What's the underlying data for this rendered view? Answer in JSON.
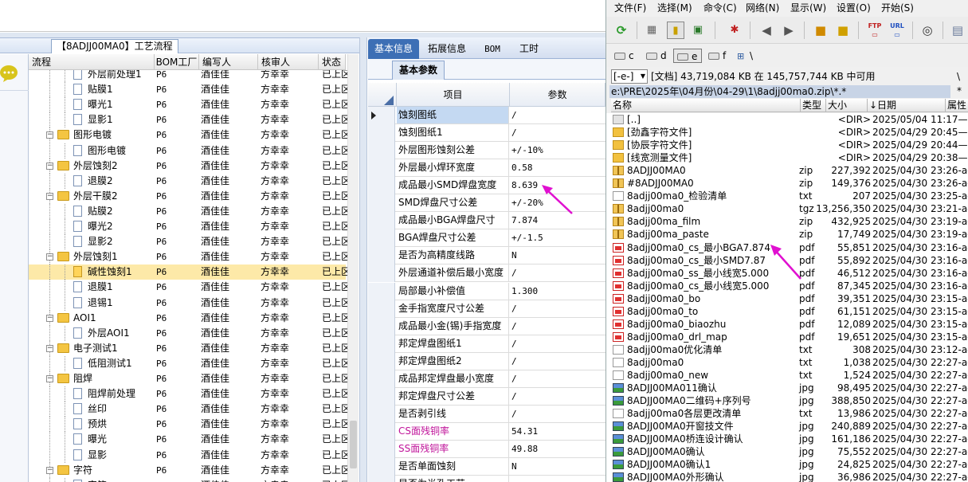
{
  "workflow_panel": {
    "title": "【8ADJJ00MA0】工艺流程",
    "columns": [
      "流程",
      "BOM工厂",
      "编写人",
      "核审人",
      "状态"
    ],
    "rows": [
      {
        "level": 2,
        "kind": "doc",
        "name": "外层前处理1",
        "bom": "P6",
        "author": "酒佳佳",
        "reviewer": "方幸幸",
        "status": "已上区"
      },
      {
        "level": 2,
        "kind": "doc",
        "name": "贴膜1",
        "bom": "P6",
        "author": "酒佳佳",
        "reviewer": "方幸幸",
        "status": "已上区"
      },
      {
        "level": 2,
        "kind": "doc",
        "name": "曝光1",
        "bom": "P6",
        "author": "酒佳佳",
        "reviewer": "方幸幸",
        "status": "已上区"
      },
      {
        "level": 2,
        "kind": "doc",
        "name": "显影1",
        "bom": "P6",
        "author": "酒佳佳",
        "reviewer": "方幸幸",
        "status": "已上区"
      },
      {
        "level": 1,
        "kind": "folder",
        "name": "图形电镀",
        "bom": "P6",
        "author": "酒佳佳",
        "reviewer": "方幸幸",
        "status": "已上区"
      },
      {
        "level": 2,
        "kind": "doc",
        "name": "图形电镀",
        "bom": "P6",
        "author": "酒佳佳",
        "reviewer": "方幸幸",
        "status": "已上区"
      },
      {
        "level": 1,
        "kind": "folder",
        "name": "外层蚀刻2",
        "bom": "P6",
        "author": "酒佳佳",
        "reviewer": "方幸幸",
        "status": "已上区"
      },
      {
        "level": 2,
        "kind": "doc",
        "name": "退膜2",
        "bom": "P6",
        "author": "酒佳佳",
        "reviewer": "方幸幸",
        "status": "已上区"
      },
      {
        "level": 1,
        "kind": "folder",
        "name": "外层干膜2",
        "bom": "P6",
        "author": "酒佳佳",
        "reviewer": "方幸幸",
        "status": "已上区"
      },
      {
        "level": 2,
        "kind": "doc",
        "name": "贴膜2",
        "bom": "P6",
        "author": "酒佳佳",
        "reviewer": "方幸幸",
        "status": "已上区"
      },
      {
        "level": 2,
        "kind": "doc",
        "name": "曝光2",
        "bom": "P6",
        "author": "酒佳佳",
        "reviewer": "方幸幸",
        "status": "已上区"
      },
      {
        "level": 2,
        "kind": "doc",
        "name": "显影2",
        "bom": "P6",
        "author": "酒佳佳",
        "reviewer": "方幸幸",
        "status": "已上区"
      },
      {
        "level": 1,
        "kind": "folder",
        "name": "外层蚀刻1",
        "bom": "P6",
        "author": "酒佳佳",
        "reviewer": "方幸幸",
        "status": "已上区"
      },
      {
        "level": 2,
        "kind": "doc",
        "name": "碱性蚀刻1",
        "bom": "P6",
        "author": "酒佳佳",
        "reviewer": "方幸幸",
        "status": "已上区",
        "selected": true
      },
      {
        "level": 2,
        "kind": "doc",
        "name": "退膜1",
        "bom": "P6",
        "author": "酒佳佳",
        "reviewer": "方幸幸",
        "status": "已上区"
      },
      {
        "level": 2,
        "kind": "doc",
        "name": "退锡1",
        "bom": "P6",
        "author": "酒佳佳",
        "reviewer": "方幸幸",
        "status": "已上区"
      },
      {
        "level": 1,
        "kind": "folder",
        "name": "AOI1",
        "bom": "P6",
        "author": "酒佳佳",
        "reviewer": "方幸幸",
        "status": "已上区"
      },
      {
        "level": 2,
        "kind": "doc",
        "name": "外层AOI1",
        "bom": "P6",
        "author": "酒佳佳",
        "reviewer": "方幸幸",
        "status": "已上区"
      },
      {
        "level": 1,
        "kind": "folder",
        "name": "电子测试1",
        "bom": "P6",
        "author": "酒佳佳",
        "reviewer": "方幸幸",
        "status": "已上区"
      },
      {
        "level": 2,
        "kind": "doc",
        "name": "低阻测试1",
        "bom": "P6",
        "author": "酒佳佳",
        "reviewer": "方幸幸",
        "status": "已上区"
      },
      {
        "level": 1,
        "kind": "folder",
        "name": "阻焊",
        "bom": "P6",
        "author": "酒佳佳",
        "reviewer": "方幸幸",
        "status": "已上区"
      },
      {
        "level": 2,
        "kind": "doc",
        "name": "阻焊前处理",
        "bom": "P6",
        "author": "酒佳佳",
        "reviewer": "方幸幸",
        "status": "已上区"
      },
      {
        "level": 2,
        "kind": "doc",
        "name": "丝印",
        "bom": "P6",
        "author": "酒佳佳",
        "reviewer": "方幸幸",
        "status": "已上区"
      },
      {
        "level": 2,
        "kind": "doc",
        "name": "预烘",
        "bom": "P6",
        "author": "酒佳佳",
        "reviewer": "方幸幸",
        "status": "已上区"
      },
      {
        "level": 2,
        "kind": "doc",
        "name": "曝光",
        "bom": "P6",
        "author": "酒佳佳",
        "reviewer": "方幸幸",
        "status": "已上区"
      },
      {
        "level": 2,
        "kind": "doc",
        "name": "显影",
        "bom": "P6",
        "author": "酒佳佳",
        "reviewer": "方幸幸",
        "status": "已上区"
      },
      {
        "level": 1,
        "kind": "folder",
        "name": "字符",
        "bom": "P6",
        "author": "酒佳佳",
        "reviewer": "方幸幸",
        "status": "已上区"
      },
      {
        "level": 2,
        "kind": "doc",
        "name": "字符",
        "bom": "P6",
        "author": "酒佳佳",
        "reviewer": "方幸幸",
        "status": "已上区"
      }
    ]
  },
  "params_panel": {
    "tabs": [
      "基本信息",
      "拓展信息",
      "BOM",
      "工时"
    ],
    "active_tab": 0,
    "subtab": "基本参数",
    "columns": [
      "项目",
      "参数"
    ],
    "rows": [
      {
        "key": "蚀刻图纸",
        "value": "/",
        "selected": true
      },
      {
        "key": "蚀刻图纸1",
        "value": "/"
      },
      {
        "key": "外层图形蚀刻公差",
        "value": "+/-10%"
      },
      {
        "key": "外层最小焊环宽度",
        "value": "0.58"
      },
      {
        "key": "成品最小SMD焊盘宽度",
        "value": "8.639"
      },
      {
        "key": "SMD焊盘尺寸公差",
        "value": "+/-20%"
      },
      {
        "key": "成品最小BGA焊盘尺寸",
        "value": "7.874"
      },
      {
        "key": "BGA焊盘尺寸公差",
        "value": "+/-1.5"
      },
      {
        "key": "是否为高精度线路",
        "value": "N"
      },
      {
        "key": "外层通道补偿后最小宽度",
        "value": "/"
      },
      {
        "key": "局部最小补偿值",
        "value": "1.300"
      },
      {
        "key": "金手指宽度尺寸公差",
        "value": "/"
      },
      {
        "key": "成品最小金(锡)手指宽度",
        "value": "/"
      },
      {
        "key": "邦定焊盘图纸1",
        "value": "/"
      },
      {
        "key": "邦定焊盘图纸2",
        "value": "/"
      },
      {
        "key": "成品邦定焊盘最小宽度",
        "value": "/"
      },
      {
        "key": "邦定焊盘尺寸公差",
        "value": "/"
      },
      {
        "key": "是否剥引线",
        "value": "/"
      },
      {
        "key": "CS面残铜率",
        "value": "54.31",
        "color": "#c0149a"
      },
      {
        "key": "SS面残铜率",
        "value": "49.88",
        "color": "#c0149a"
      },
      {
        "key": "是否单面蚀刻",
        "value": "N"
      },
      {
        "key": "是否为半孔工艺",
        "value": ""
      }
    ]
  },
  "file_manager": {
    "menu": [
      "文件(F)",
      "选择(M)",
      "命令(C)",
      "网络(N)",
      "显示(W)",
      "设置(O)",
      "开始(S)"
    ],
    "drives": [
      "c",
      "d",
      "e",
      "f",
      "\\"
    ],
    "active_drive": "e",
    "drive_select": "[-e-]",
    "disk_info": "[文档]  43,719,084 KB 在 145,757,744 KB 中可用",
    "path": "e:\\PRE\\2025年\\04月份\\04-29\\1\\8adjj00ma0.zip\\*.*",
    "columns": [
      "名称",
      "类型",
      "大小",
      "↓日期",
      "属性"
    ],
    "files": [
      {
        "icon": "up",
        "name": "[..]",
        "type": "",
        "size": "<DIR>",
        "date": "2025/05/04 11:17—"
      },
      {
        "icon": "folder",
        "name": "[劲鑫字符文件]",
        "type": "",
        "size": "<DIR>",
        "date": "2025/04/29 20:45—"
      },
      {
        "icon": "folder",
        "name": "[协辰字符文件]",
        "type": "",
        "size": "<DIR>",
        "date": "2025/04/29 20:44—"
      },
      {
        "icon": "folder",
        "name": "[线宽测量文件]",
        "type": "",
        "size": "<DIR>",
        "date": "2025/04/29 20:38—"
      },
      {
        "icon": "zip",
        "name": "8ADJJ00MA0",
        "type": "zip",
        "size": "227,392",
        "date": "2025/04/30 23:26-a-"
      },
      {
        "icon": "zip",
        "name": "#8ADJJ00MA0",
        "type": "zip",
        "size": "149,376",
        "date": "2025/04/30 23:26-a-"
      },
      {
        "icon": "txt",
        "name": "8adjj00ma0_检验清单",
        "type": "txt",
        "size": "207",
        "date": "2025/04/30 23:25-a-"
      },
      {
        "icon": "zip",
        "name": "8adjj00ma0",
        "type": "tgz",
        "size": "13,256,350",
        "date": "2025/04/30 23:21-a-"
      },
      {
        "icon": "zip",
        "name": "8adjj00ma_film",
        "type": "zip",
        "size": "432,925",
        "date": "2025/04/30 23:19-a-"
      },
      {
        "icon": "zip",
        "name": "8adjj00ma_paste",
        "type": "zip",
        "size": "17,749",
        "date": "2025/04/30 23:19-a-"
      },
      {
        "icon": "pdf",
        "name": "8adjj00ma0_cs_最小BGA7.874",
        "type": "pdf",
        "size": "55,851",
        "date": "2025/04/30 23:16-a-"
      },
      {
        "icon": "pdf",
        "name": "8adjj00ma0_cs_最小SMD7.87",
        "type": "pdf",
        "size": "55,892",
        "date": "2025/04/30 23:16-a-"
      },
      {
        "icon": "pdf",
        "name": "8adjj00ma0_ss_最小线宽5.000",
        "type": "pdf",
        "size": "46,512",
        "date": "2025/04/30 23:16-a-"
      },
      {
        "icon": "pdf",
        "name": "8adjj00ma0_cs_最小线宽5.000",
        "type": "pdf",
        "size": "87,345",
        "date": "2025/04/30 23:16-a-"
      },
      {
        "icon": "pdf",
        "name": "8adjj00ma0_bo",
        "type": "pdf",
        "size": "39,351",
        "date": "2025/04/30 23:15-a-"
      },
      {
        "icon": "pdf",
        "name": "8adjj00ma0_to",
        "type": "pdf",
        "size": "61,151",
        "date": "2025/04/30 23:15-a-"
      },
      {
        "icon": "pdf",
        "name": "8adjj00ma0_biaozhu",
        "type": "pdf",
        "size": "12,089",
        "date": "2025/04/30 23:15-a-"
      },
      {
        "icon": "pdf",
        "name": "8adjj00ma0_drl_map",
        "type": "pdf",
        "size": "19,651",
        "date": "2025/04/30 23:15-a-"
      },
      {
        "icon": "txt",
        "name": "8adjj00ma0优化清单",
        "type": "txt",
        "size": "308",
        "date": "2025/04/30 23:12-a-"
      },
      {
        "icon": "txt",
        "name": "8adjj00ma0",
        "type": "txt",
        "size": "1,038",
        "date": "2025/04/30 22:27-a-"
      },
      {
        "icon": "txt",
        "name": "8adjj00ma0_new",
        "type": "txt",
        "size": "1,524",
        "date": "2025/04/30 22:27-a-"
      },
      {
        "icon": "jpg",
        "name": "8ADJJ00MA011确认",
        "type": "jpg",
        "size": "98,495",
        "date": "2025/04/30 22:27-a-"
      },
      {
        "icon": "jpg",
        "name": "8ADJJ00MA0二维码+序列号",
        "type": "jpg",
        "size": "388,850",
        "date": "2025/04/30 22:27-a-"
      },
      {
        "icon": "txt",
        "name": "8adjj00ma0各层更改清单",
        "type": "txt",
        "size": "13,986",
        "date": "2025/04/30 22:27-a-"
      },
      {
        "icon": "jpg",
        "name": "8ADJJ00MA0开窗技文件",
        "type": "jpg",
        "size": "240,889",
        "date": "2025/04/30 22:27-a-"
      },
      {
        "icon": "jpg",
        "name": "8ADJJ00MA0桥连设计确认",
        "type": "jpg",
        "size": "161,186",
        "date": "2025/04/30 22:27-a-"
      },
      {
        "icon": "jpg",
        "name": "8ADJJ00MA0确认",
        "type": "jpg",
        "size": "75,552",
        "date": "2025/04/30 22:27-a-"
      },
      {
        "icon": "jpg",
        "name": "8ADJJ00MA0确认1",
        "type": "jpg",
        "size": "24,825",
        "date": "2025/04/30 22:27-a-"
      },
      {
        "icon": "jpg",
        "name": "8ADJJ00MA0外形确认",
        "type": "jpg",
        "size": "36,986",
        "date": "2025/04/30 22:27-a-"
      }
    ]
  },
  "annotation_color": "#e010d0"
}
